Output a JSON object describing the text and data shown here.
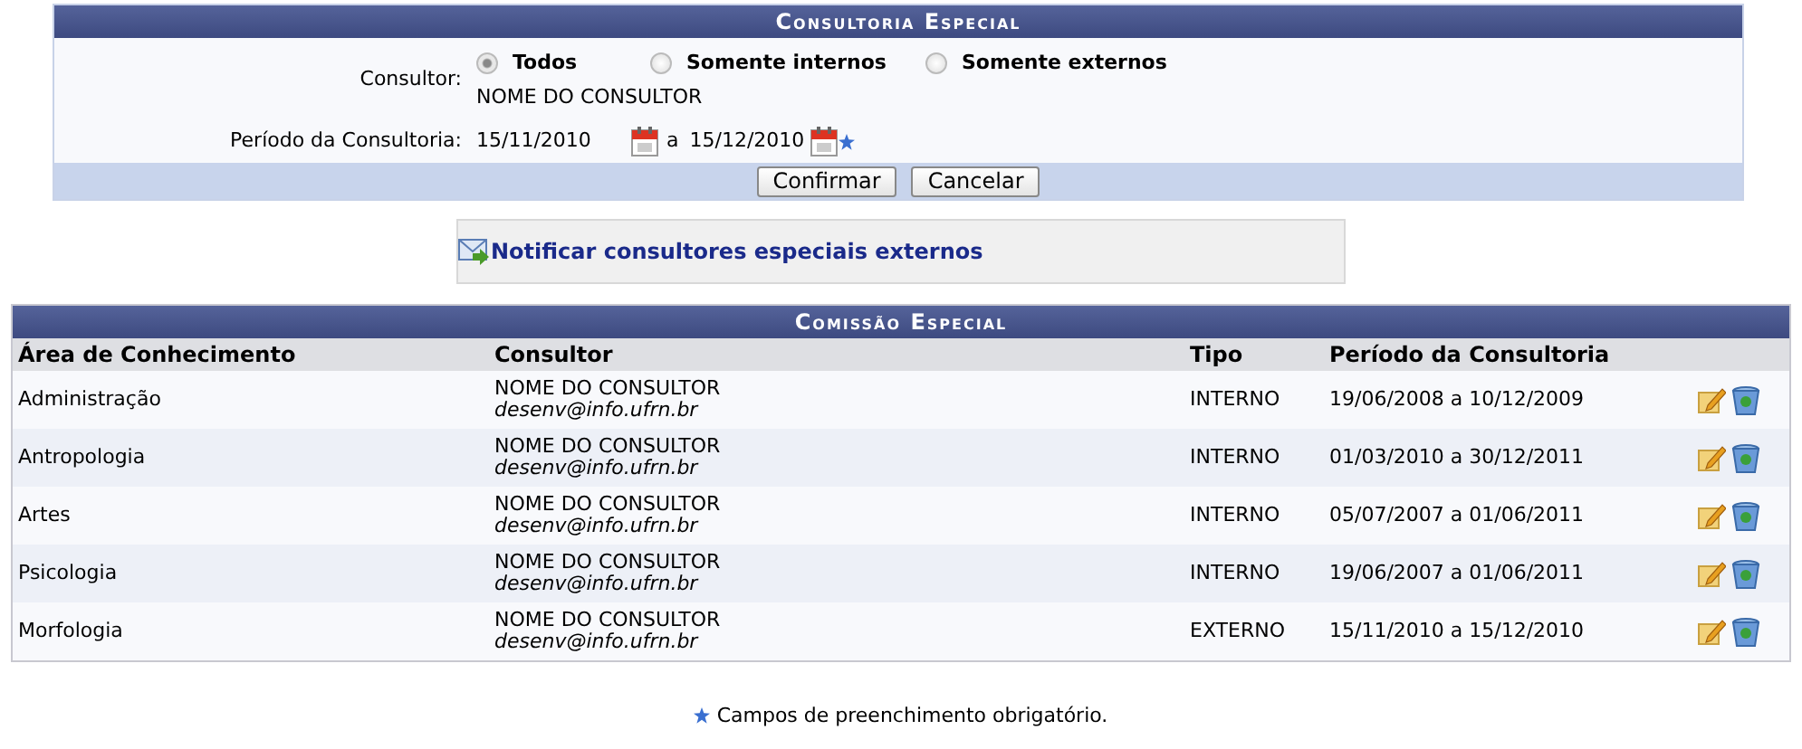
{
  "form": {
    "title": "Consultoria Especial",
    "consultor_label": "Consultor:",
    "options": [
      {
        "label": "Todos",
        "selected": true
      },
      {
        "label": "Somente internos",
        "selected": false
      },
      {
        "label": "Somente externos",
        "selected": false
      }
    ],
    "consultor_name": "NOME DO CONSULTOR",
    "period_label": "Período da Consultoria:",
    "date_start": "15/11/2010",
    "separator": "a",
    "date_end": "15/12/2010",
    "required": true,
    "buttons": [
      "Confirmar",
      "Cancelar"
    ]
  },
  "notify_link": "Notificar consultores especiais externos",
  "table": {
    "title": "Comissão Especial",
    "columns": [
      "Área de Conhecimento",
      "Consultor",
      "Tipo",
      "Período da Consultoria"
    ],
    "rows": [
      {
        "area": "Administração",
        "name": "NOME DO CONSULTOR",
        "email": "desenv@info.ufrn.br",
        "type": "INTERNO",
        "period": "19/06/2008 a 10/12/2009"
      },
      {
        "area": "Antropologia",
        "name": "NOME DO CONSULTOR",
        "email": "desenv@info.ufrn.br",
        "type": "INTERNO",
        "period": "01/03/2010 a 30/12/2011"
      },
      {
        "area": "Artes",
        "name": "NOME DO CONSULTOR",
        "email": "desenv@info.ufrn.br",
        "type": "INTERNO",
        "period": "05/07/2007 a 01/06/2011"
      },
      {
        "area": "Psicologia",
        "name": "NOME DO CONSULTOR",
        "email": "desenv@info.ufrn.br",
        "type": "INTERNO",
        "period": "19/06/2007 a 01/06/2011"
      },
      {
        "area": "Morfologia",
        "name": "NOME DO CONSULTOR",
        "email": "desenv@info.ufrn.br",
        "type": "EXTERNO",
        "period": "15/11/2010 a 15/12/2010"
      }
    ]
  },
  "footer_note": "Campos de preenchimento obrigatório."
}
